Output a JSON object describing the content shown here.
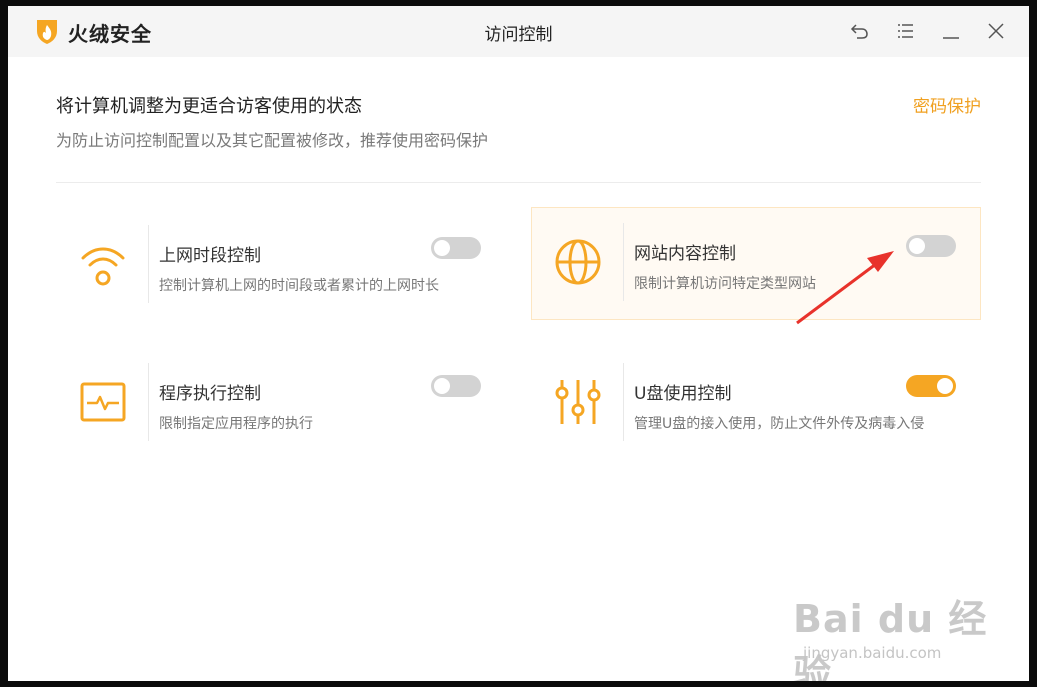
{
  "app": {
    "brand": "火绒安全",
    "window_title": "访问控制"
  },
  "header": {
    "headline": "将计算机调整为更适合访客使用的状态",
    "subline": "为防止访问控制配置以及其它配置被修改，推荐使用密码保护",
    "password_link": "密码保护"
  },
  "cards": [
    {
      "title": "上网时段控制",
      "desc": "控制计算机上网的时间段或者累计的上网时长",
      "icon": "wifi-icon",
      "enabled": false
    },
    {
      "title": "网站内容控制",
      "desc": "限制计算机访问特定类型网站",
      "icon": "globe-icon",
      "enabled": false
    },
    {
      "title": "程序执行控制",
      "desc": "限制指定应用程序的执行",
      "icon": "program-monitor-icon",
      "enabled": false
    },
    {
      "title": "U盘使用控制",
      "desc": "管理U盘的接入使用，防止文件外传及病毒入侵",
      "icon": "usb-sliders-icon",
      "enabled": true
    }
  ],
  "colors": {
    "accent": "#f5a623",
    "link": "#f0a020",
    "annotation_arrow": "#e8322b"
  },
  "watermark": {
    "brand": "Bai du 经验",
    "url": "jingyan.baidu.com"
  }
}
